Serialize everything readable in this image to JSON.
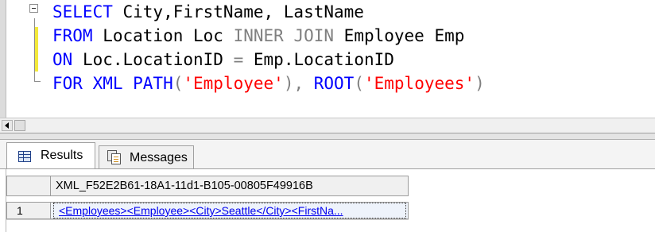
{
  "editor": {
    "lines": [
      [
        {
          "t": "SELECT",
          "c": "kw"
        },
        {
          "t": " City,FirstName, LastName",
          "c": "id"
        }
      ],
      [
        {
          "t": "FROM",
          "c": "kw"
        },
        {
          "t": " Location Loc ",
          "c": "id"
        },
        {
          "t": "INNER JOIN",
          "c": "gray"
        },
        {
          "t": " Employee Emp",
          "c": "id"
        }
      ],
      [
        {
          "t": "ON",
          "c": "kw"
        },
        {
          "t": " Loc.LocationID ",
          "c": "id"
        },
        {
          "t": "=",
          "c": "gray"
        },
        {
          "t": " Emp.LocationID",
          "c": "id"
        }
      ],
      [
        {
          "t": "FOR XML PATH",
          "c": "kw"
        },
        {
          "t": "(",
          "c": "gray"
        },
        {
          "t": "'Employee'",
          "c": "str"
        },
        {
          "t": "), ",
          "c": "gray"
        },
        {
          "t": "ROOT",
          "c": "kw"
        },
        {
          "t": "(",
          "c": "gray"
        },
        {
          "t": "'Employees'",
          "c": "str"
        },
        {
          "t": ")",
          "c": "gray"
        }
      ]
    ]
  },
  "tabs": {
    "results_label": "Results",
    "messages_label": "Messages"
  },
  "grid": {
    "column_header": "XML_F52E2B61-18A1-11d1-B105-00805F49916B",
    "row_number": "1",
    "cell_value": "<Employees><Employee><City>Seattle</City><FirstNa..."
  },
  "colors": {
    "keyword": "#0000ff",
    "string": "#ff0000",
    "operator": "#808080",
    "link": "#0000ee"
  }
}
